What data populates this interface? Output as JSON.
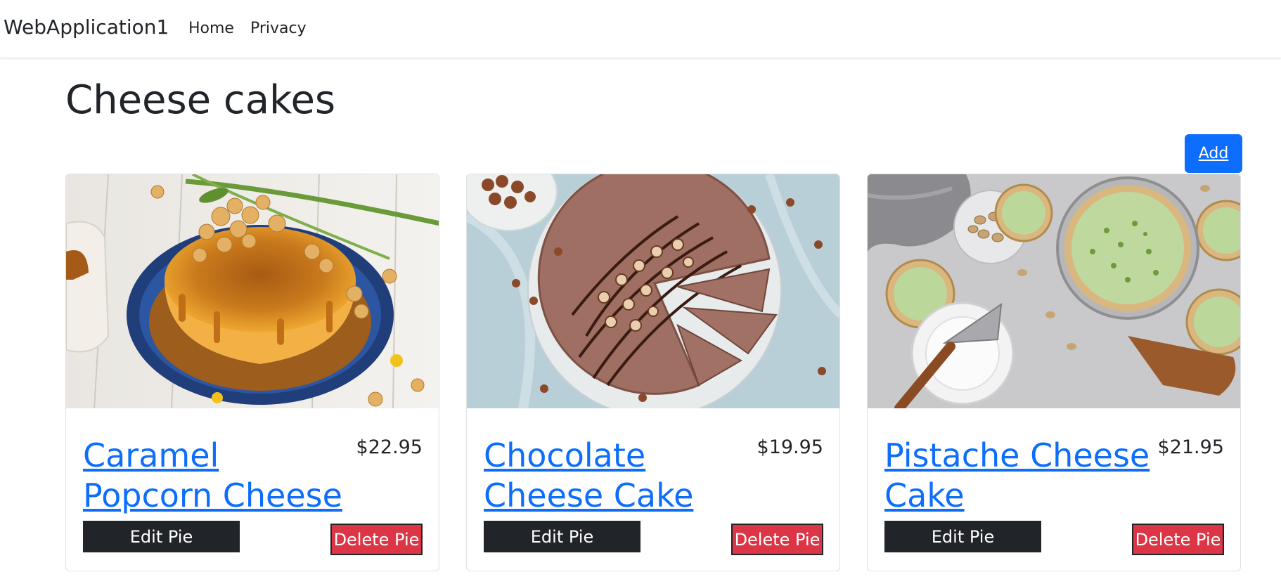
{
  "navbar": {
    "brand": "WebApplication1",
    "links": [
      "Home",
      "Privacy"
    ]
  },
  "page": {
    "title": "Cheese cakes",
    "add_label": "Add"
  },
  "cards": [
    {
      "title": "Caramel Popcorn Cheese Cake",
      "price": "$22.95",
      "edit_label": "Edit Pie",
      "delete_label": "Delete Pie",
      "image": "caramel-popcorn-cheesecake-photo"
    },
    {
      "title": "Chocolate Cheese Cake",
      "price": "$19.95",
      "edit_label": "Edit Pie",
      "delete_label": "Delete Pie",
      "image": "chocolate-cheesecake-photo"
    },
    {
      "title": "Pistache Cheese Cake",
      "price": "$21.95",
      "edit_label": "Edit Pie",
      "delete_label": "Delete Pie",
      "image": "pistachio-cheesecake-photo"
    }
  ],
  "colors": {
    "primary": "#0d6efd",
    "dark": "#212529",
    "danger": "#dc3545",
    "border": "#dee2e6"
  }
}
